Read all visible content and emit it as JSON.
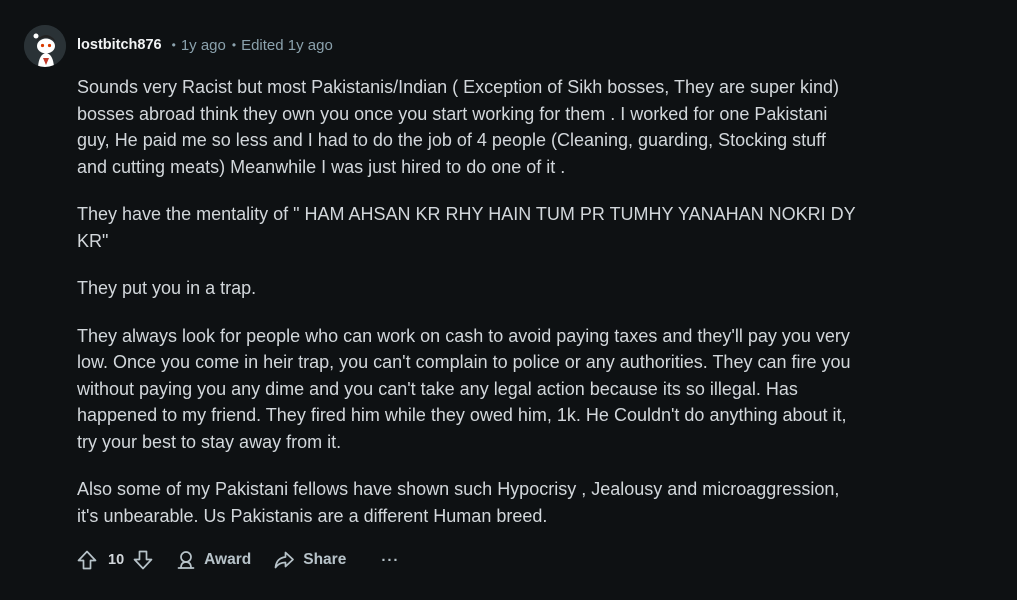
{
  "comment": {
    "username": "lostbitch876",
    "time": "1y ago",
    "edited": "Edited 1y ago",
    "paragraphs": [
      "Sounds very Racist but most Pakistanis/Indian ( Exception of Sikh bosses, They are super kind) bosses abroad think they own you once you start working for them . I worked for one Pakistani guy, He paid me so less and I had to do the job of 4 people (Cleaning, guarding, Stocking stuff and cutting meats) Meanwhile I was just hired to do one of it .",
      "They have the mentality of \" HAM AHSAN KR RHY HAIN TUM PR TUMHY YANAHAN NOKRI DY KR\"",
      "They put you in a trap.",
      "They always look for people who can work on cash to avoid paying taxes and they'll pay you very low. Once you come in heir trap, you can't complain to police or any authorities. They can fire you without paying you any dime and you can't take any legal action because its so illegal. Has happened to my friend. They fired him while they owed him, 1k. He Couldn't do anything about it, try your best to stay away from it.",
      "Also some of my Pakistani fellows have shown such Hypocrisy , Jealousy and microaggression, it's unbearable. Us Pakistanis are a different Human breed."
    ],
    "score": "10",
    "award_label": "Award",
    "share_label": "Share",
    "more_label": "···"
  },
  "icons": {
    "upvote": "upvote-icon",
    "downvote": "downvote-icon",
    "award": "award-icon",
    "share": "share-icon",
    "more": "more-icon"
  },
  "colors": {
    "background": "#0e1113",
    "text": "#d2d7db",
    "muted": "#8ba2ad"
  }
}
